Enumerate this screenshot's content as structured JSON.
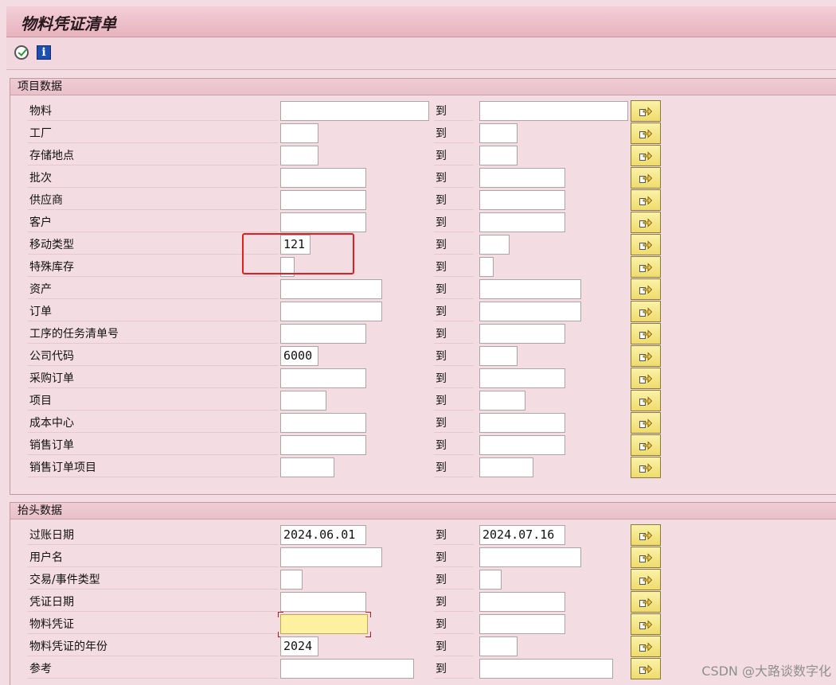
{
  "window": {
    "title": "物料凭证清单"
  },
  "toolbar": {
    "execute_icon": "execute-clock-icon",
    "info_label": "i"
  },
  "item_group": {
    "title": "项目数据",
    "to_label": "到",
    "rows": [
      {
        "label": "物料",
        "low": "",
        "high": ""
      },
      {
        "label": "工厂",
        "low": "",
        "high": ""
      },
      {
        "label": "存储地点",
        "low": "",
        "high": ""
      },
      {
        "label": "批次",
        "low": "",
        "high": ""
      },
      {
        "label": "供应商",
        "low": "",
        "high": ""
      },
      {
        "label": "客户",
        "low": "",
        "high": ""
      },
      {
        "label": "移动类型",
        "low": "121",
        "high": ""
      },
      {
        "label": "特殊库存",
        "low": "",
        "high": ""
      },
      {
        "label": "资产",
        "low": "",
        "high": ""
      },
      {
        "label": "订单",
        "low": "",
        "high": ""
      },
      {
        "label": "工序的任务清单号",
        "low": "",
        "high": ""
      },
      {
        "label": "公司代码",
        "low": "6000",
        "high": ""
      },
      {
        "label": "采购订单",
        "low": "",
        "high": ""
      },
      {
        "label": "项目",
        "low": "",
        "high": ""
      },
      {
        "label": "成本中心",
        "low": "",
        "high": ""
      },
      {
        "label": "销售订单",
        "low": "",
        "high": ""
      },
      {
        "label": "销售订单项目",
        "low": "",
        "high": ""
      }
    ]
  },
  "header_group": {
    "title": "抬头数据",
    "to_label": "到",
    "rows": [
      {
        "label": "过账日期",
        "low": "2024.06.01",
        "high": "2024.07.16"
      },
      {
        "label": "用户名",
        "low": "",
        "high": ""
      },
      {
        "label": "交易/事件类型",
        "low": "",
        "high": ""
      },
      {
        "label": "凭证日期",
        "low": "",
        "high": ""
      },
      {
        "label": "物料凭证",
        "low": "",
        "high": ""
      },
      {
        "label": "物料凭证的年份",
        "low": "2024",
        "high": ""
      },
      {
        "label": "参考",
        "low": "",
        "high": ""
      }
    ]
  },
  "watermark": "CSDN @大路谈数字化",
  "colors": {
    "background": "#f4dde2",
    "highlight": "#e02020",
    "multi_button": "#f3e27a"
  }
}
